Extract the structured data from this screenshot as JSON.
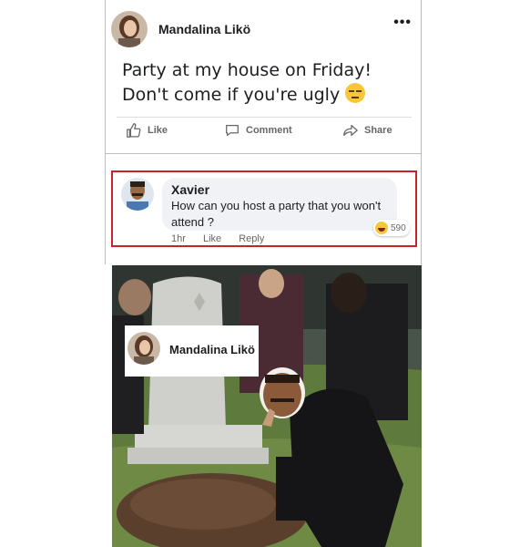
{
  "post": {
    "author": "Mandalina Likö",
    "more_label": "•••",
    "text_line1": "Party at my house on Friday!",
    "text_line2": "Don't come if you're ugly",
    "emoji": "unamused-face-icon"
  },
  "actions": {
    "like": "Like",
    "comment": "Comment",
    "share": "Share"
  },
  "comment": {
    "author": "Xavier",
    "text": "How can you host a party that you won't attend ?",
    "time": "1hr",
    "like": "Like",
    "reply": "Reply",
    "reaction_icon": "haha-reaction-icon",
    "reaction_count": "590"
  },
  "meme": {
    "tag_name": "Mandalina Likö"
  },
  "colors": {
    "highlight_border": "#c8222a",
    "text": "#1c1e21",
    "muted": "#65676b",
    "bubble": "#f0f2f5"
  }
}
